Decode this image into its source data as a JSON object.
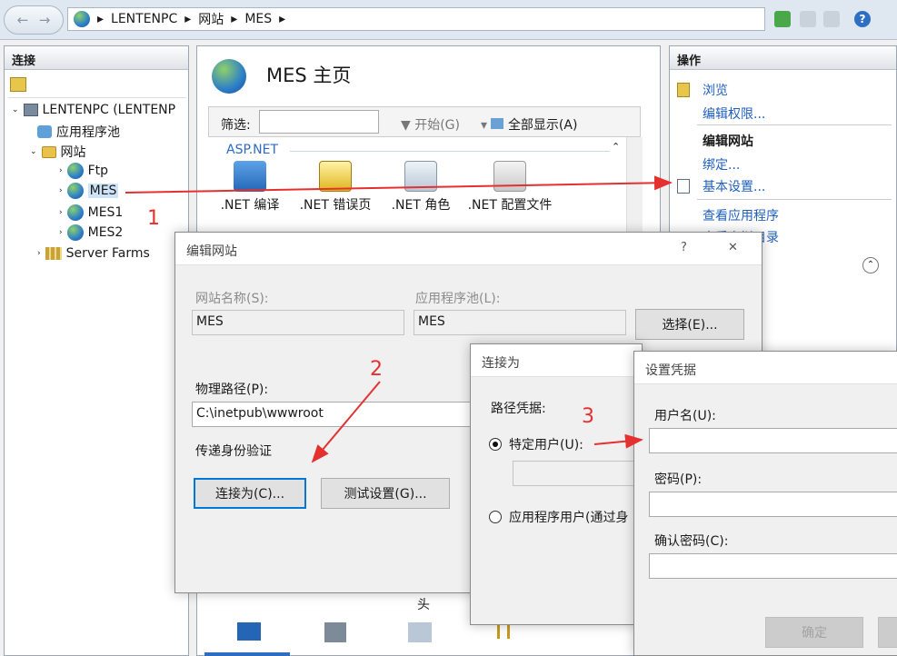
{
  "address_bar": {
    "back_glyph": "←",
    "forward_glyph": "→",
    "crumbs": [
      "LENTENPC",
      "网站",
      "MES"
    ],
    "help_label": "?"
  },
  "connections_panel": {
    "title": "连接",
    "tree": [
      {
        "label": "LENTENPC (LENTENP",
        "icon": "server-icon"
      },
      {
        "label": "应用程序池",
        "icon": "app-pool-icon"
      },
      {
        "label": "网站",
        "icon": "folder-icon"
      },
      {
        "label": "Ftp",
        "icon": "globe-icon"
      },
      {
        "label": "MES",
        "icon": "globe-icon",
        "selected": true
      },
      {
        "label": "MES1",
        "icon": "globe-icon"
      },
      {
        "label": "MES2",
        "icon": "globe-icon"
      },
      {
        "label": "Server Farms",
        "icon": "server-farm-icon"
      }
    ]
  },
  "center_panel": {
    "title": "MES 主页",
    "filter_label": "筛选:",
    "start_label": "开始(G)",
    "show_all_label": "全部显示(A)",
    "group_label": "ASP.NET",
    "features": [
      ".NET 编译",
      ".NET 错误页",
      ".NET 角色",
      ".NET 配置文件"
    ],
    "bottom_text": "头"
  },
  "actions_panel": {
    "title": "操作",
    "browse": "浏览",
    "edit_permissions": "编辑权限...",
    "edit_site_heading": "编辑网站",
    "bindings": "绑定...",
    "basic_settings": "基本设置...",
    "view_apps": "查看应用程序",
    "view_vdirs": "查看虚拟目录"
  },
  "edit_site_dialog": {
    "title": "编辑网站",
    "help": "?",
    "close": "✕",
    "site_name_label": "网站名称(S):",
    "site_name_value": "MES",
    "app_pool_label": "应用程序池(L):",
    "app_pool_value": "MES",
    "select_button": "选择(E)...",
    "physical_path_label": "物理路径(P):",
    "physical_path_value": "C:\\inetpub\\wwwroot",
    "pass_through_label": "传递身份验证",
    "connect_as_button": "连接为(C)...",
    "test_settings_button": "测试设置(G)..."
  },
  "connect_as_dialog": {
    "title": "连接为",
    "path_credentials_label": "路径凭据:",
    "specific_user_label": "特定用户(U):",
    "app_user_label": "应用程序用户(通过身"
  },
  "set_credentials_dialog": {
    "title": "设置凭据",
    "username_label": "用户名(U):",
    "password_label": "密码(P):",
    "confirm_password_label": "确认密码(C):",
    "ok_button": "确定"
  },
  "annotations": {
    "step1": "1",
    "step2": "2",
    "step3": "3",
    "color": "#e53030"
  }
}
